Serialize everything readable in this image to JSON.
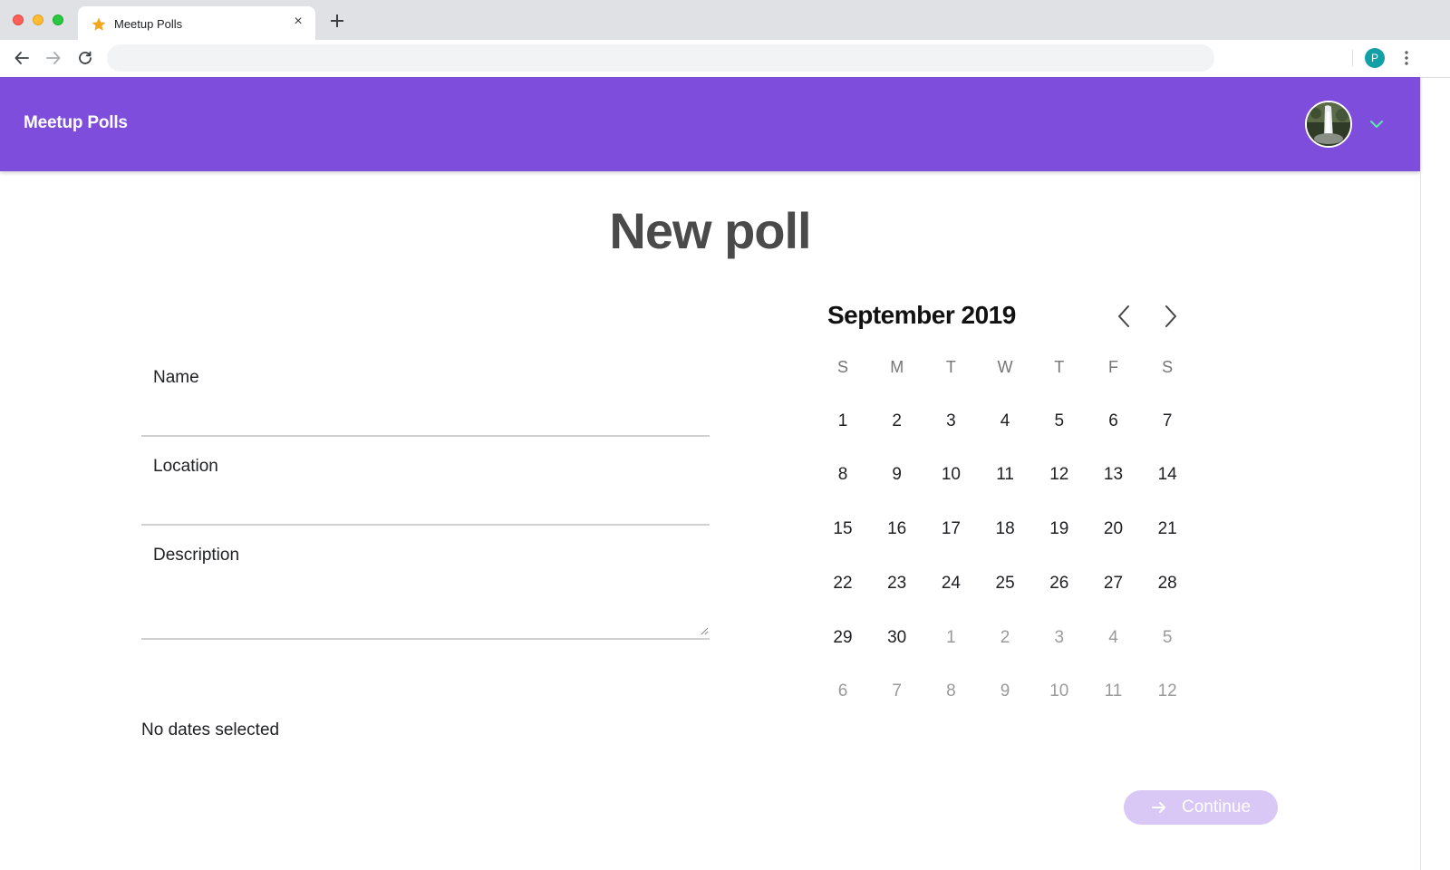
{
  "browser": {
    "tab_title": "Meetup Polls",
    "tab_close_glyph": "×",
    "address_value": "",
    "profile_initial": "P",
    "icons": {
      "favicon": "star-icon",
      "new_tab": "plus-icon",
      "back": "arrow-left-icon",
      "forward": "arrow-right-icon",
      "reload": "reload-icon",
      "menu": "kebab-menu-icon"
    }
  },
  "header": {
    "app_title": "Meetup Polls",
    "brand_color": "#7e4ddc",
    "accent_color": "#5ee7b2"
  },
  "page": {
    "title": "New poll"
  },
  "form": {
    "name_label": "Name",
    "name_value": "",
    "location_label": "Location",
    "location_value": "",
    "description_label": "Description",
    "description_value": "",
    "selected_dates_text": "No dates selected"
  },
  "calendar": {
    "month_label": "September 2019",
    "weekdays": [
      "S",
      "M",
      "T",
      "W",
      "T",
      "F",
      "S"
    ],
    "weeks": [
      [
        {
          "d": "1",
          "cur": true
        },
        {
          "d": "2",
          "cur": true
        },
        {
          "d": "3",
          "cur": true
        },
        {
          "d": "4",
          "cur": true
        },
        {
          "d": "5",
          "cur": true
        },
        {
          "d": "6",
          "cur": true
        },
        {
          "d": "7",
          "cur": true
        }
      ],
      [
        {
          "d": "8",
          "cur": true
        },
        {
          "d": "9",
          "cur": true
        },
        {
          "d": "10",
          "cur": true
        },
        {
          "d": "11",
          "cur": true
        },
        {
          "d": "12",
          "cur": true
        },
        {
          "d": "13",
          "cur": true
        },
        {
          "d": "14",
          "cur": true
        }
      ],
      [
        {
          "d": "15",
          "cur": true
        },
        {
          "d": "16",
          "cur": true
        },
        {
          "d": "17",
          "cur": true
        },
        {
          "d": "18",
          "cur": true
        },
        {
          "d": "19",
          "cur": true
        },
        {
          "d": "20",
          "cur": true
        },
        {
          "d": "21",
          "cur": true
        }
      ],
      [
        {
          "d": "22",
          "cur": true
        },
        {
          "d": "23",
          "cur": true
        },
        {
          "d": "24",
          "cur": true
        },
        {
          "d": "25",
          "cur": true
        },
        {
          "d": "26",
          "cur": true
        },
        {
          "d": "27",
          "cur": true
        },
        {
          "d": "28",
          "cur": true
        }
      ],
      [
        {
          "d": "29",
          "cur": true
        },
        {
          "d": "30",
          "cur": true
        },
        {
          "d": "1",
          "cur": false
        },
        {
          "d": "2",
          "cur": false
        },
        {
          "d": "3",
          "cur": false
        },
        {
          "d": "4",
          "cur": false
        },
        {
          "d": "5",
          "cur": false
        }
      ],
      [
        {
          "d": "6",
          "cur": false
        },
        {
          "d": "7",
          "cur": false
        },
        {
          "d": "8",
          "cur": false
        },
        {
          "d": "9",
          "cur": false
        },
        {
          "d": "10",
          "cur": false
        },
        {
          "d": "11",
          "cur": false
        },
        {
          "d": "12",
          "cur": false
        }
      ]
    ]
  },
  "actions": {
    "continue_label": "Continue",
    "continue_disabled": true,
    "continue_color": "#d9c8f6"
  }
}
